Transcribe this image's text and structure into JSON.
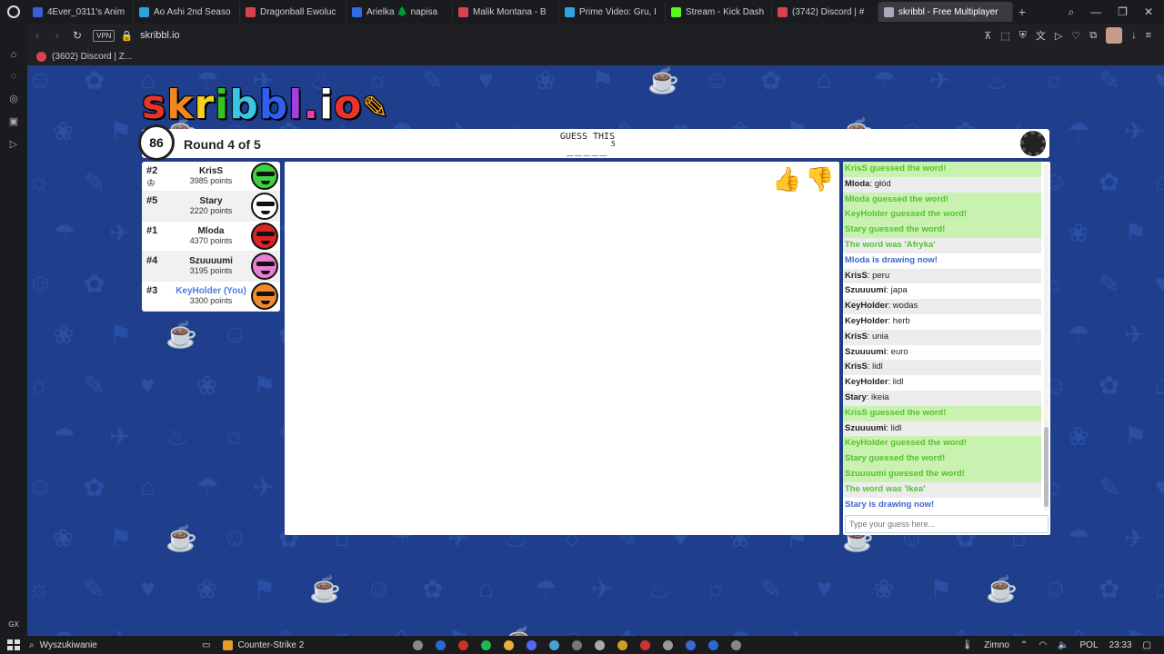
{
  "browser": {
    "tabs": [
      {
        "label": "4Ever_0311's Anim",
        "color": "#3b5fd6"
      },
      {
        "label": "Ao Ashi 2nd Seaso",
        "color": "#2aa5e0"
      },
      {
        "label": "Dragonball Ewoluc",
        "color": "#d9434d"
      },
      {
        "label": "Arielka 🌲 napisa",
        "color": "#2d6ee8"
      },
      {
        "label": "Malik Montana - B",
        "color": "#d9434d"
      },
      {
        "label": "Prime Video: Gru, I",
        "color": "#2aa5e0"
      },
      {
        "label": "Stream - Kick Dash",
        "color": "#53fc18"
      },
      {
        "label": "(3742) Discord | #",
        "color": "#d9434d"
      },
      {
        "label": "skribbl - Free Multiplayer",
        "color": "#aab"
      }
    ],
    "url": "skribbl.io",
    "vpn": "VPN",
    "bookmark": "(3602) Discord | Z..."
  },
  "logo": {
    "letters": [
      "s",
      "k",
      "r",
      "i",
      "b",
      "b",
      "l",
      ".",
      "i",
      "o"
    ]
  },
  "game": {
    "timer": "86",
    "round": "Round 4 of 5",
    "guess_label": "GUESS THIS",
    "blanks": "_____",
    "word_length": "5"
  },
  "players": [
    {
      "rank": "#2",
      "name": "KrisS",
      "points": "3985 points",
      "color": "#3fd13f",
      "crown": true,
      "you": false
    },
    {
      "rank": "#5",
      "name": "Stary",
      "points": "2220 points",
      "color": "#ffffff",
      "crown": false,
      "you": false
    },
    {
      "rank": "#1",
      "name": "Mloda",
      "points": "4370 points",
      "color": "#d82626",
      "crown": false,
      "you": false
    },
    {
      "rank": "#4",
      "name": "Szuuuumi",
      "points": "3195 points",
      "color": "#e77fd5",
      "crown": false,
      "you": false
    },
    {
      "rank": "#3",
      "name": "KeyHolder (You)",
      "points": "3300 points",
      "color": "#f08a2c",
      "crown": false,
      "you": true
    }
  ],
  "chat": {
    "messages": [
      {
        "type": "correct",
        "text": "KrisS guessed the word!"
      },
      {
        "type": "msg",
        "user": "Mloda",
        "text": "głód"
      },
      {
        "type": "correct",
        "text": "Mloda guessed the word!"
      },
      {
        "type": "correct",
        "text": "KeyHolder guessed the word!"
      },
      {
        "type": "correct",
        "text": "Stary guessed the word!"
      },
      {
        "type": "word",
        "text": "The word was 'Afryka'"
      },
      {
        "type": "draw",
        "text": "Mloda is drawing now!"
      },
      {
        "type": "msg",
        "user": "KrisS",
        "text": "peru"
      },
      {
        "type": "msg",
        "user": "Szuuuumi",
        "text": "japa"
      },
      {
        "type": "msg",
        "user": "KeyHolder",
        "text": "wodas"
      },
      {
        "type": "msg",
        "user": "KeyHolder",
        "text": "herb"
      },
      {
        "type": "msg",
        "user": "KrisS",
        "text": "unia"
      },
      {
        "type": "msg",
        "user": "Szuuuumi",
        "text": "euro"
      },
      {
        "type": "msg",
        "user": "KrisS",
        "text": "lidl"
      },
      {
        "type": "msg",
        "user": "KeyHolder",
        "text": "lidl"
      },
      {
        "type": "msg",
        "user": "Stary",
        "text": "ikeia"
      },
      {
        "type": "correct",
        "text": "KrisS guessed the word!"
      },
      {
        "type": "msg",
        "user": "Szuuuumi",
        "text": "lidl"
      },
      {
        "type": "correct",
        "text": "KeyHolder guessed the word!"
      },
      {
        "type": "correct",
        "text": "Stary guessed the word!"
      },
      {
        "type": "correct",
        "text": "Szuuuumi guessed the word!"
      },
      {
        "type": "word",
        "text": "The word was 'Ikea'"
      },
      {
        "type": "draw",
        "text": "Stary is drawing now!"
      }
    ],
    "placeholder": "Type your guess here..."
  },
  "taskbar": {
    "search": "Wyszukiwanie",
    "app": "Counter-Strike 2",
    "weather": "Zimno",
    "lang": "POL",
    "time": "23:33"
  }
}
